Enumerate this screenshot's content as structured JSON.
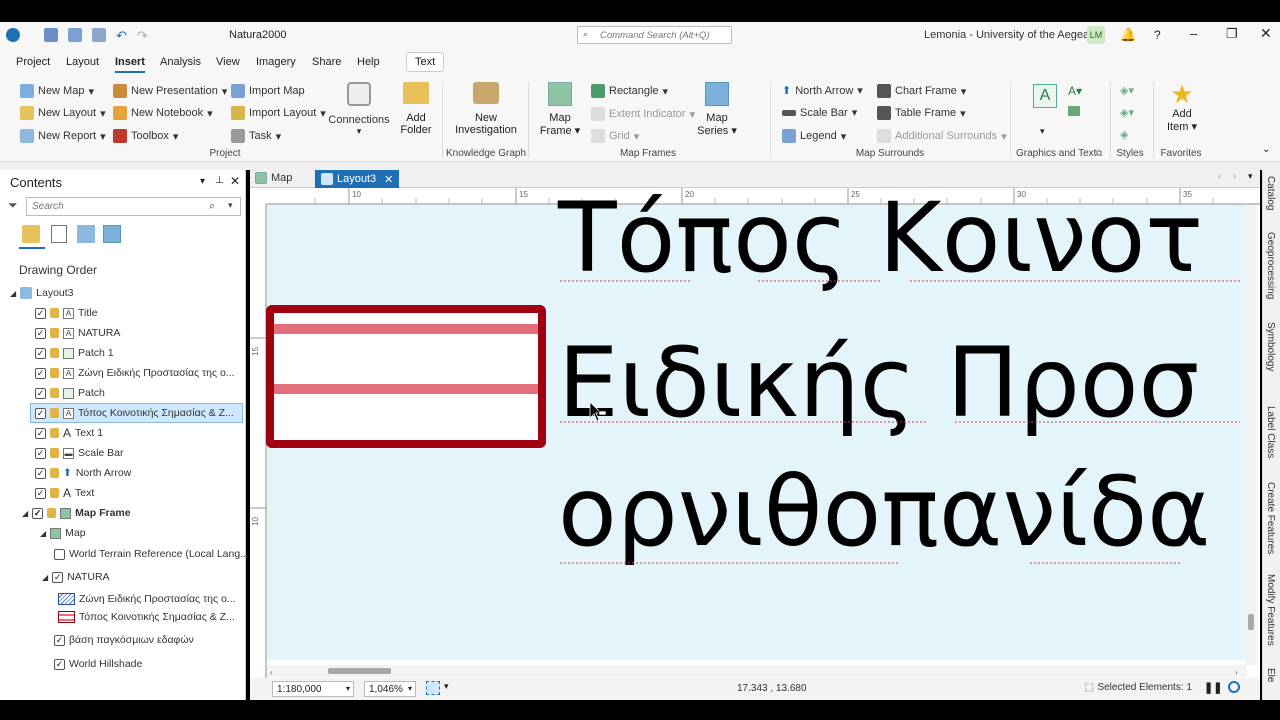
{
  "title_bar": {
    "project_name": "Natura2000",
    "search_placeholder": "Command Search (Alt+Q)",
    "user_org": "Lemonia - University of the Aegean",
    "user_initials": "LM",
    "help": "?"
  },
  "menu": {
    "project": "Project",
    "layout": "Layout",
    "insert": "Insert",
    "analysis": "Analysis",
    "view": "View",
    "imagery": "Imagery",
    "share": "Share",
    "help": "Help",
    "text": "Text"
  },
  "ribbon": {
    "new_map": "New Map",
    "new_layout": "New Layout",
    "new_report": "New Report",
    "new_presentation": "New Presentation",
    "new_notebook": "New Notebook",
    "toolbox": "Toolbox",
    "import_map": "Import Map",
    "import_layout": "Import Layout",
    "task": "Task",
    "connections": "Connections",
    "add_folder_1": "Add",
    "add_folder_2": "Folder",
    "project_group": "Project",
    "new_investigation_1": "New",
    "new_investigation_2": "Investigation",
    "knowledge_graph_group": "Knowledge Graph",
    "map_frame_1": "Map",
    "map_frame_2": "Frame",
    "rectangle": "Rectangle",
    "extent_indicator": "Extent Indicator",
    "grid": "Grid",
    "map_series_1": "Map",
    "map_series_2": "Series",
    "map_frames_group": "Map Frames",
    "north_arrow": "North Arrow",
    "scale_bar": "Scale Bar",
    "legend": "Legend",
    "chart_frame": "Chart Frame",
    "table_frame": "Table Frame",
    "additional_surrounds": "Additional Surrounds",
    "map_surrounds_group": "Map Surrounds",
    "graphics_text_group": "Graphics and Text",
    "styles_group": "Styles",
    "add_item_1": "Add",
    "add_item_2": "Item",
    "favorites_group": "Favorites"
  },
  "contents": {
    "title": "Contents",
    "search_placeholder": "Search",
    "drawing_order": "Drawing Order",
    "items": [
      {
        "label": "Layout3"
      },
      {
        "label": "Title"
      },
      {
        "label": "NATURA"
      },
      {
        "label": "Patch 1"
      },
      {
        "label": "Ζώνη Ειδικής Προστασίας της ο..."
      },
      {
        "label": "Patch"
      },
      {
        "label": "Τόπος Κοινοτικής Σημασίας & Ζ..."
      },
      {
        "label": "Text 1"
      },
      {
        "label": "Scale Bar"
      },
      {
        "label": "North Arrow"
      },
      {
        "label": "Text"
      },
      {
        "label": "Map Frame"
      },
      {
        "label": "Map"
      },
      {
        "label": "World Terrain Reference (Local Lang..."
      },
      {
        "label": "NATURA"
      },
      {
        "label": "Ζώνη Ειδικής Προστασίας της ο..."
      },
      {
        "label": "Τόπος Κοινοτικής Σημασίας & Ζ..."
      },
      {
        "label": "βάση παγκόσμιων εδαφών"
      },
      {
        "label": "World Hillshade"
      }
    ]
  },
  "tabs": {
    "map": "Map",
    "layout3": "Layout3"
  },
  "ruler": {
    "top": [
      "10",
      "15",
      "20",
      "25",
      "30",
      "35"
    ],
    "left": [
      "15",
      "10"
    ]
  },
  "canvas": {
    "line1": "Τόπος Κοινοτ",
    "line2": "Ειδικής Προσ",
    "line3": "ορνιθοπανίδα"
  },
  "status": {
    "scale": "1:180,000",
    "zoom": "1,046%",
    "coords": "17.343 , 13.680",
    "selected": "Selected Elements: 1"
  },
  "right_tabs": [
    "Catalog",
    "Geoprocessing",
    "Symbology",
    "Label Class",
    "Create Features",
    "Modify Features",
    "Ele"
  ],
  "colors": {
    "accent": "#1f6fb5",
    "canvas_bg": "#e4f4fb",
    "patch_border": "#a0000f",
    "patch_stripe": "#e36f7b",
    "selection": "#cde8ff"
  }
}
